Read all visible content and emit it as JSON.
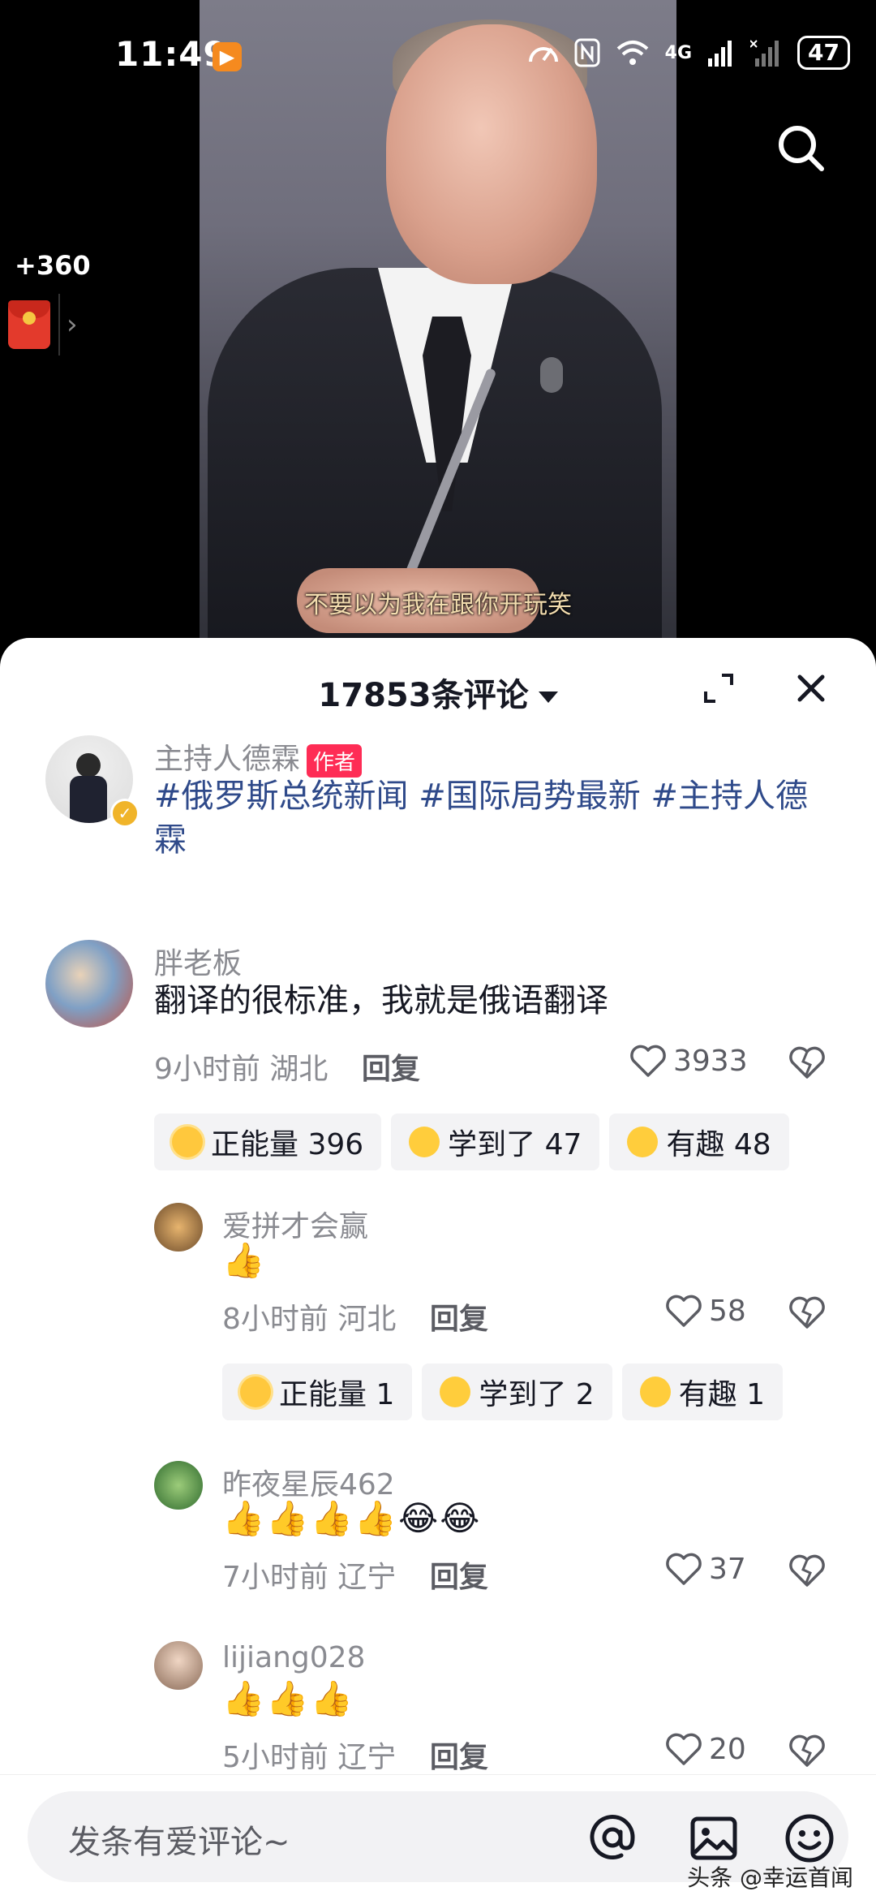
{
  "status_bar": {
    "time": "11:49",
    "battery": "47",
    "network": "4G"
  },
  "video": {
    "subtitle": "不要以为我在跟你开玩笑"
  },
  "reward": {
    "amount": "+360"
  },
  "comments_panel": {
    "count_label": "17853条评论",
    "comments": [
      {
        "user": "主持人德霖",
        "badge": "作者",
        "text": "#俄罗斯总统新闻 #国际局势最新 #主持人德霖"
      },
      {
        "user": "胖老板",
        "text": "翻译的很标准，我就是俄语翻译",
        "time": "9小时前",
        "location": "湖北",
        "reply": "回复",
        "likes": "3933",
        "reactions": [
          {
            "label": "正能量 396"
          },
          {
            "label": "学到了 47"
          },
          {
            "label": "有趣 48"
          }
        ]
      },
      {
        "user": "爱拼才会赢",
        "text": "👍",
        "time": "8小时前",
        "location": "河北",
        "reply": "回复",
        "likes": "58",
        "reactions": [
          {
            "label": "正能量 1"
          },
          {
            "label": "学到了 2"
          },
          {
            "label": "有趣 1"
          }
        ]
      },
      {
        "user": "昨夜星辰462",
        "text": "👍👍👍👍😂😂",
        "time": "7小时前",
        "location": "辽宁",
        "reply": "回复",
        "likes": "37"
      },
      {
        "user": "lijiang028",
        "text": "👍👍👍",
        "time": "5小时前",
        "location": "辽宁",
        "reply": "回复",
        "likes": "20"
      }
    ]
  },
  "input": {
    "placeholder": "发条有爱评论~"
  },
  "watermark": "头条 @幸运首闻",
  "colors": {
    "accent": "#fe2c55",
    "hashtag": "#2f4a8a"
  }
}
